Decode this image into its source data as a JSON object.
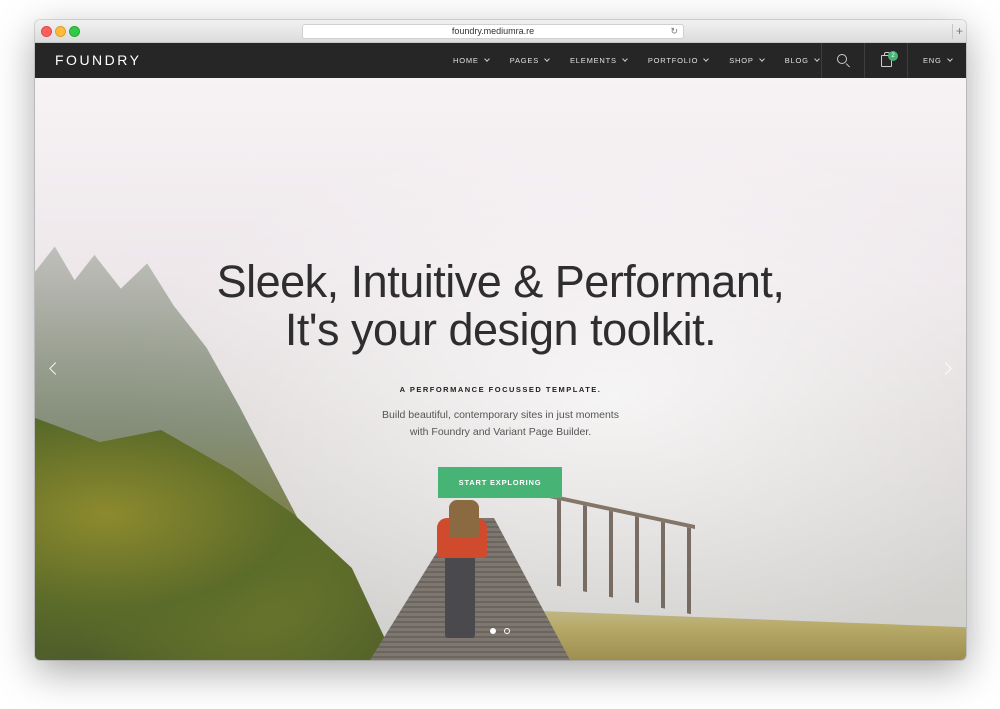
{
  "browser": {
    "url": "foundry.mediumra.re",
    "reload_icon": "reload-icon",
    "newtab_icon": "plus-icon"
  },
  "nav": {
    "logo": "FOUNDRY",
    "items": [
      {
        "label": "HOME"
      },
      {
        "label": "PAGES"
      },
      {
        "label": "ELEMENTS"
      },
      {
        "label": "PORTFOLIO"
      },
      {
        "label": "SHOP"
      },
      {
        "label": "BLOG"
      }
    ],
    "cart_count": "2",
    "language": "ENG"
  },
  "hero": {
    "headline_line1": "Sleek, Intuitive & Performant,",
    "headline_line2": "It's your design toolkit.",
    "tagline": "A PERFORMANCE FOCUSSED TEMPLATE.",
    "sub_line1": "Build beautiful, contemporary sites in just moments",
    "sub_line2": "with Foundry and Variant Page Builder.",
    "cta_label": "START EXPLORING"
  },
  "colors": {
    "accent": "#47b475",
    "navbar": "#262626"
  }
}
